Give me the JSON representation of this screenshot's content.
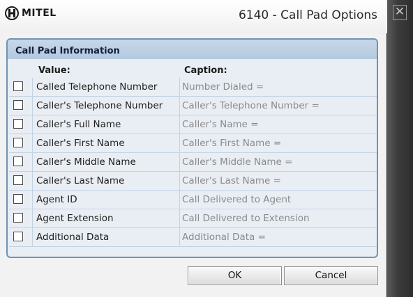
{
  "window": {
    "logo_text": "MITEL",
    "title": "6140 - Call Pad Options",
    "close_glyph": "✕"
  },
  "group": {
    "title": "Call Pad Information",
    "headers": {
      "value": "Value:",
      "caption": "Caption:"
    },
    "rows": [
      {
        "value": "Called Telephone Number",
        "caption": "Number Dialed =",
        "checked": false
      },
      {
        "value": "Caller's Telephone Number",
        "caption": "Caller's Telephone Number =",
        "checked": false
      },
      {
        "value": "Caller's Full Name",
        "caption": "Caller's Name =",
        "checked": false
      },
      {
        "value": "Caller's First Name",
        "caption": "Caller's First Name =",
        "checked": false
      },
      {
        "value": "Caller's Middle Name",
        "caption": "Caller's Middle Name =",
        "checked": false
      },
      {
        "value": "Caller's Last Name",
        "caption": "Caller's Last Name =",
        "checked": false
      },
      {
        "value": "Agent ID",
        "caption": "Call Delivered to Agent",
        "checked": false
      },
      {
        "value": "Agent Extension",
        "caption": "Call Delivered to Extension",
        "checked": false
      },
      {
        "value": "Additional Data",
        "caption": "Additional Data =",
        "checked": false
      }
    ]
  },
  "buttons": {
    "ok": "OK",
    "cancel": "Cancel"
  },
  "icons": {
    "logo": "mitel-logo-icon",
    "close": "close-icon",
    "checkbox": "checkbox-icon"
  },
  "colors": {
    "group_border": "#6f93b6",
    "group_title_bg": "#b4c9df",
    "caption_text": "#8a8a8a"
  }
}
